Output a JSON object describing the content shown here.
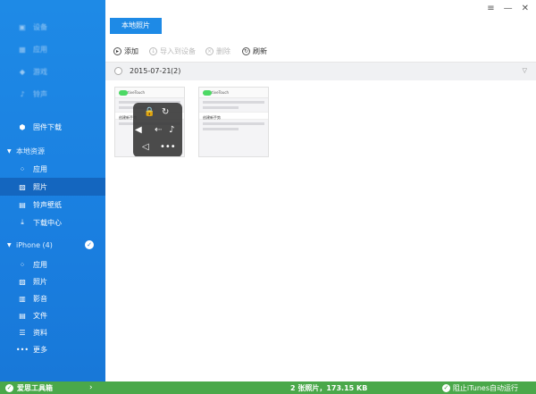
{
  "sidebar": {
    "top_items": [
      {
        "label": "设备",
        "icon": "device-icon"
      },
      {
        "label": "应用",
        "icon": "apps-icon"
      },
      {
        "label": "游戏",
        "icon": "game-icon"
      },
      {
        "label": "铃声",
        "icon": "ringtone-icon"
      },
      {
        "label": "固件下载",
        "icon": "firmware-download-icon"
      }
    ],
    "local_section": "本地资源",
    "local_items": [
      {
        "label": "应用",
        "icon": "apps-icon"
      },
      {
        "label": "照片",
        "icon": "photo-icon"
      },
      {
        "label": "铃声壁纸",
        "icon": "ringtone-wallpaper-icon"
      },
      {
        "label": "下载中心",
        "icon": "download-center-icon"
      }
    ],
    "device_section": "iPhone (4)",
    "device_items": [
      {
        "label": "应用",
        "icon": "apps-icon"
      },
      {
        "label": "照片",
        "icon": "photo-icon"
      },
      {
        "label": "影音",
        "icon": "media-icon"
      },
      {
        "label": "文件",
        "icon": "file-icon"
      },
      {
        "label": "资料",
        "icon": "contacts-icon"
      },
      {
        "label": "更多",
        "icon": "more-icon"
      }
    ],
    "footer": "爱思工具箱"
  },
  "topbar": {
    "tab": "本地照片",
    "controls": [
      "menu-icon",
      "minimize-icon",
      "close-icon"
    ]
  },
  "toolbar": {
    "add": "添加",
    "import": "导入到设备",
    "delete": "删除",
    "refresh": "刷新"
  },
  "group": {
    "date": "2015-07-21",
    "count": "(2)"
  },
  "photos": [
    {
      "title": "AssistiveTouch",
      "row": "创建新手势",
      "overlay": true
    },
    {
      "title": "AssistiveTouch",
      "row": "创建新手势",
      "overlay": false
    }
  ],
  "status": {
    "count": "2 张照片，173.15 KB",
    "itunes": "阻止iTunes自动运行"
  },
  "colors": {
    "sidebar": "#1a7fe0",
    "active": "#1466bf",
    "status": "#4aa84a",
    "accent": "#1e8ae6"
  }
}
